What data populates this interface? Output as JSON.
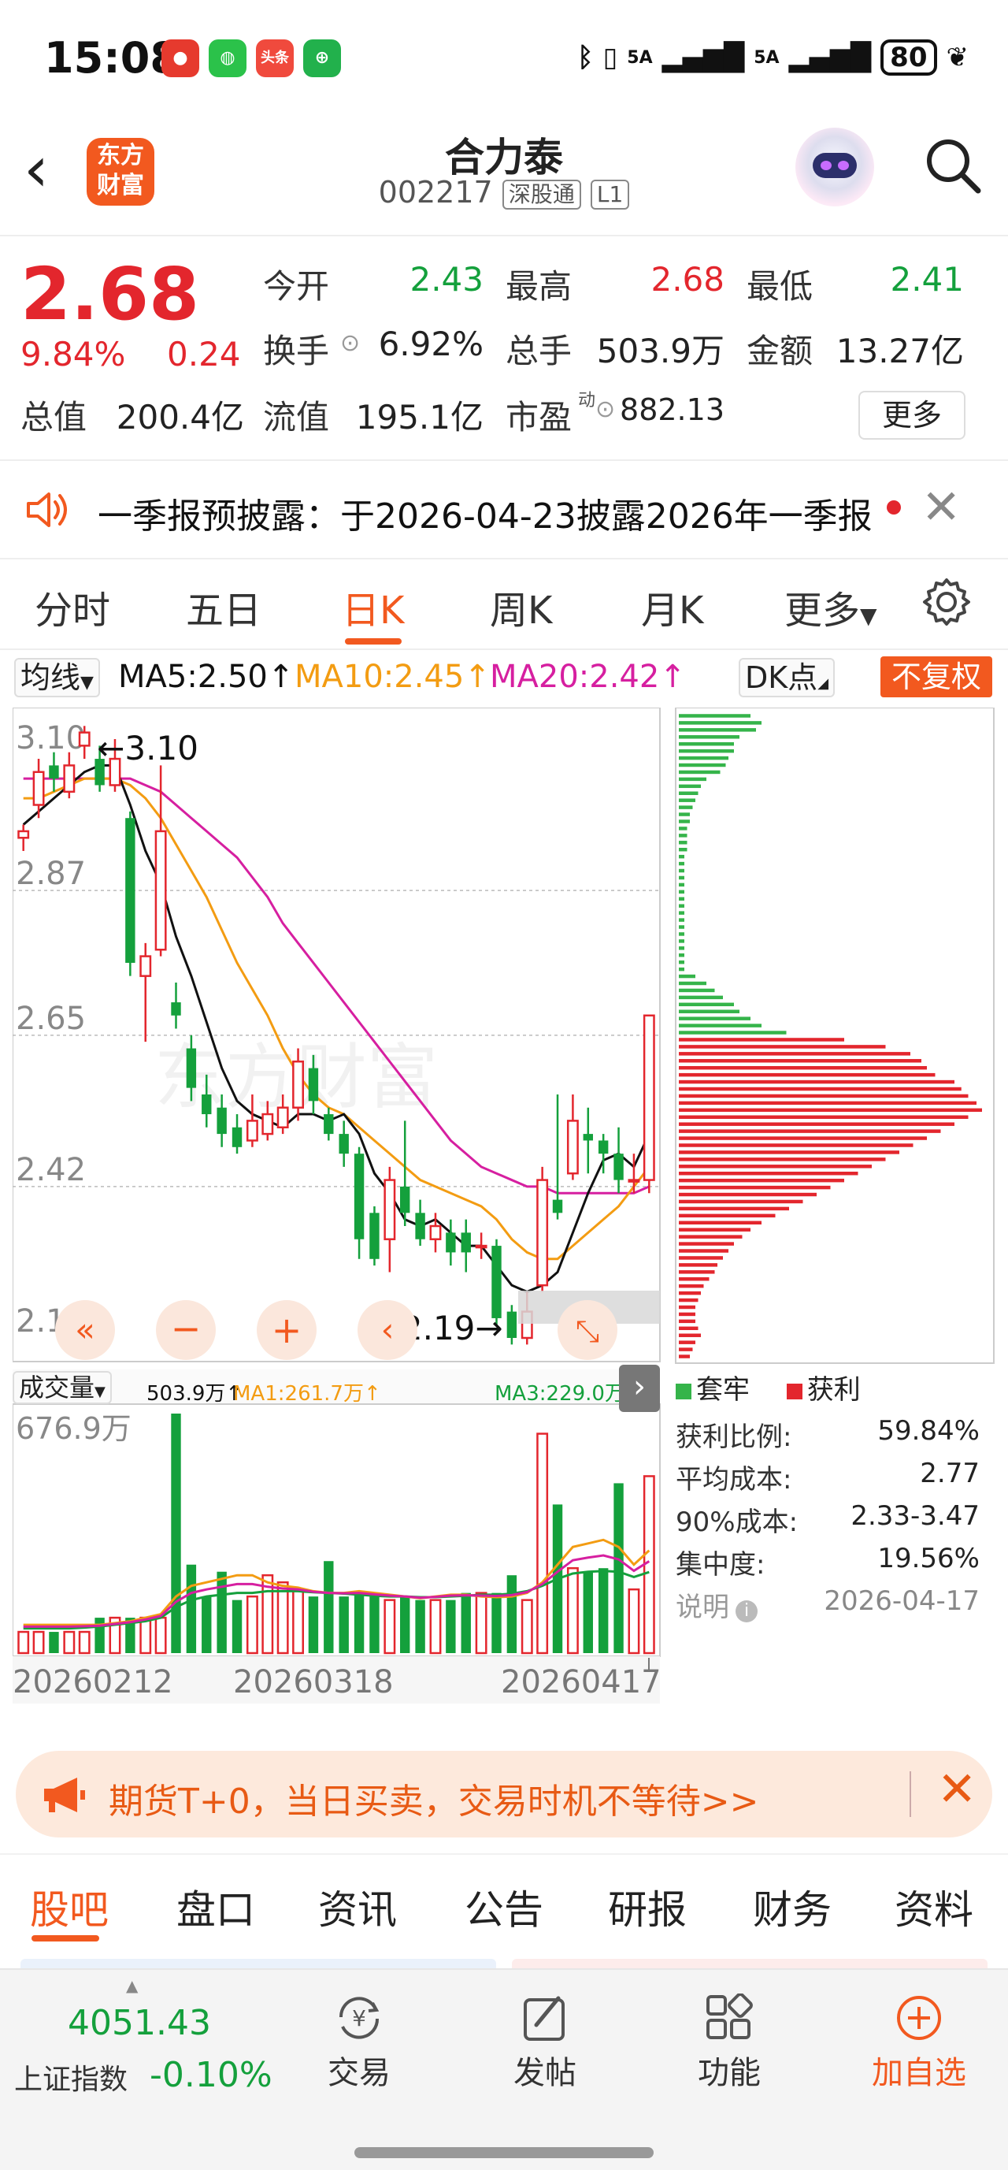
{
  "status_bar": {
    "time": "15:08",
    "app_icons": [
      "网易",
      "微信",
      "头条",
      "店"
    ],
    "signal_1": "5A",
    "signal_2": "5A",
    "battery": "80"
  },
  "header": {
    "logo_text": "东方\n财富",
    "stock_name": "合力泰",
    "stock_code": "002217",
    "tags": [
      "深股通",
      "L1"
    ]
  },
  "quote": {
    "price": "2.68",
    "change_pct": "9.84%",
    "change": "0.24",
    "fields": [
      {
        "label": "今开",
        "value": "2.43",
        "color": "green"
      },
      {
        "label": "最高",
        "value": "2.68",
        "color": "red"
      },
      {
        "label": "最低",
        "value": "2.41",
        "color": "green"
      },
      {
        "label": "换手",
        "value": "6.92%",
        "color": "black"
      },
      {
        "label": "总手",
        "value": "503.9万",
        "color": "black"
      },
      {
        "label": "金额",
        "value": "13.27亿",
        "color": "black"
      },
      {
        "label": "总值",
        "value": "200.4亿",
        "color": "black"
      },
      {
        "label": "流值",
        "value": "195.1亿",
        "color": "black"
      },
      {
        "label": "市盈",
        "value": "882.13",
        "color": "black"
      }
    ],
    "pe_superscript": "动",
    "more_label": "更多"
  },
  "notice": {
    "text": "一季报预披露：于2026-04-23披露2026年一季报"
  },
  "period_tabs": [
    "分时",
    "五日",
    "日K",
    "周K",
    "月K",
    "更多"
  ],
  "active_period": "日K",
  "ma_legend": {
    "selector": "均线",
    "ma5": "MA5:2.50↑",
    "ma10": "MA10:2.45↑",
    "ma20": "MA20:2.42↑",
    "dk_label": "DK点",
    "adjust_label": "不复权"
  },
  "volume_legend": {
    "selector": "成交量",
    "vol": "503.9万↑",
    "ma1": "MA1:261.7万↑",
    "ma3": "MA3:229.0万↑"
  },
  "chart_data": [
    {
      "type": "candlestick",
      "title": "日K",
      "y_ticks": [
        "3.10",
        "2.87",
        "2.65",
        "2.42",
        "2.19"
      ],
      "ylim": [
        2.19,
        3.1
      ],
      "annotations": [
        "3.10",
        "2.19"
      ],
      "candles": [
        [
          2.95,
          2.96,
          2.97,
          2.93
        ],
        [
          3.0,
          3.05,
          3.07,
          2.98
        ],
        [
          3.06,
          3.04,
          3.08,
          3.02
        ],
        [
          3.02,
          3.06,
          3.08,
          3.01
        ],
        [
          3.09,
          3.11,
          3.12,
          3.07
        ],
        [
          3.07,
          3.03,
          3.09,
          3.02
        ],
        [
          3.03,
          3.07,
          3.1,
          3.02
        ],
        [
          2.98,
          2.76,
          2.99,
          2.74
        ],
        [
          2.74,
          2.77,
          2.79,
          2.64
        ],
        [
          2.78,
          2.96,
          3.06,
          2.77
        ],
        [
          2.7,
          2.68,
          2.73,
          2.66
        ],
        [
          2.63,
          2.57,
          2.65,
          2.55
        ],
        [
          2.56,
          2.53,
          2.59,
          2.51
        ],
        [
          2.54,
          2.5,
          2.56,
          2.48
        ],
        [
          2.51,
          2.48,
          2.53,
          2.47
        ],
        [
          2.49,
          2.52,
          2.56,
          2.48
        ],
        [
          2.5,
          2.53,
          2.55,
          2.49
        ],
        [
          2.51,
          2.54,
          2.56,
          2.5
        ],
        [
          2.54,
          2.61,
          2.63,
          2.52
        ],
        [
          2.6,
          2.55,
          2.62,
          2.53
        ],
        [
          2.53,
          2.5,
          2.54,
          2.49
        ],
        [
          2.5,
          2.47,
          2.52,
          2.45
        ],
        [
          2.47,
          2.34,
          2.48,
          2.31
        ],
        [
          2.38,
          2.31,
          2.39,
          2.3
        ],
        [
          2.34,
          2.43,
          2.45,
          2.29
        ],
        [
          2.42,
          2.38,
          2.52,
          2.36
        ],
        [
          2.38,
          2.34,
          2.4,
          2.33
        ],
        [
          2.34,
          2.36,
          2.38,
          2.32
        ],
        [
          2.35,
          2.32,
          2.37,
          2.3
        ],
        [
          2.35,
          2.32,
          2.37,
          2.29
        ],
        [
          2.33,
          2.33,
          2.35,
          2.31
        ],
        [
          2.33,
          2.22,
          2.34,
          2.21
        ],
        [
          2.23,
          2.19,
          2.24,
          2.18
        ],
        [
          2.19,
          2.23,
          2.26,
          2.18
        ],
        [
          2.27,
          2.43,
          2.45,
          2.26
        ],
        [
          2.4,
          2.38,
          2.56,
          2.37
        ],
        [
          2.44,
          2.52,
          2.56,
          2.43
        ],
        [
          2.5,
          2.49,
          2.54,
          2.44
        ],
        [
          2.49,
          2.47,
          2.5,
          2.44
        ],
        [
          2.47,
          2.43,
          2.51,
          2.41
        ],
        [
          2.43,
          2.43,
          2.47,
          2.41
        ],
        [
          2.43,
          2.68,
          2.68,
          2.41
        ]
      ],
      "ma5": [
        2.97,
        2.99,
        3.01,
        3.03,
        3.05,
        3.06,
        3.06,
        3.0,
        2.93,
        2.88,
        2.8,
        2.74,
        2.67,
        2.6,
        2.55,
        2.53,
        2.52,
        2.51,
        2.53,
        2.53,
        2.52,
        2.53,
        2.5,
        2.44,
        2.41,
        2.37,
        2.36,
        2.37,
        2.35,
        2.33,
        2.33,
        2.3,
        2.27,
        2.26,
        2.27,
        2.29,
        2.35,
        2.41,
        2.46,
        2.47,
        2.45,
        2.5
      ],
      "ma10": [
        3.01,
        3.01,
        3.02,
        3.03,
        3.04,
        3.04,
        3.04,
        3.03,
        3.01,
        2.98,
        2.94,
        2.9,
        2.86,
        2.81,
        2.76,
        2.72,
        2.68,
        2.63,
        2.59,
        2.56,
        2.54,
        2.53,
        2.51,
        2.49,
        2.47,
        2.45,
        2.43,
        2.42,
        2.41,
        2.4,
        2.39,
        2.37,
        2.34,
        2.32,
        2.31,
        2.31,
        2.33,
        2.35,
        2.37,
        2.39,
        2.42,
        2.45
      ],
      "ma20": [
        3.04,
        3.04,
        3.04,
        3.04,
        3.04,
        3.04,
        3.04,
        3.04,
        3.03,
        3.02,
        3.0,
        2.98,
        2.96,
        2.94,
        2.92,
        2.89,
        2.86,
        2.82,
        2.79,
        2.76,
        2.73,
        2.7,
        2.67,
        2.64,
        2.61,
        2.58,
        2.55,
        2.52,
        2.49,
        2.47,
        2.45,
        2.44,
        2.43,
        2.42,
        2.42,
        2.41,
        2.41,
        2.41,
        2.41,
        2.41,
        2.41,
        2.42
      ],
      "color_up": "#e3262d",
      "color_down": "#14a03c",
      "ma_colors": {
        "ma5": "#111111",
        "ma10": "#f39c12",
        "ma20": "#d61fa0"
      }
    },
    {
      "type": "bar",
      "title": "成交量",
      "y_ticks": [
        "676.9万"
      ],
      "ylim": [
        0,
        676.9
      ],
      "x_ticks": [
        "20260212",
        "20260318",
        "20260417"
      ],
      "values": [
        60,
        60,
        60,
        60,
        60,
        100,
        100,
        100,
        100,
        100,
        676.9,
        250,
        160,
        230,
        150,
        160,
        220,
        200,
        180,
        160,
        260,
        160,
        170,
        160,
        150,
        160,
        150,
        150,
        150,
        170,
        170,
        170,
        220,
        150,
        620,
        420,
        240,
        230,
        240,
        480,
        180,
        500
      ],
      "ma1": [
        80,
        80,
        80,
        80,
        80,
        80,
        85,
        90,
        100,
        110,
        160,
        190,
        200,
        210,
        220,
        220,
        200,
        190,
        185,
        175,
        170,
        170,
        175,
        170,
        165,
        160,
        155,
        160,
        165,
        165,
        160,
        158,
        160,
        170,
        200,
        250,
        300,
        310,
        320,
        300,
        250,
        290
      ],
      "ma3": [
        70,
        70,
        70,
        70,
        72,
        75,
        80,
        85,
        90,
        100,
        130,
        150,
        160,
        165,
        170,
        170,
        175,
        175,
        175,
        172,
        170,
        168,
        165,
        162,
        160,
        160,
        158,
        158,
        160,
        162,
        165,
        165,
        168,
        175,
        190,
        210,
        225,
        230,
        232,
        230,
        215,
        229
      ]
    },
    {
      "type": "bar",
      "title": "筹码分布",
      "orientation": "horizontal",
      "legend": [
        "套牢",
        "获利"
      ],
      "profit_ratio": "59.84%",
      "avg_cost": "2.77",
      "cost_90": "2.33-3.47",
      "concentration": "19.56%",
      "date": "2026-04-17"
    }
  ],
  "chip_panel": {
    "legend_trapped": "套牢",
    "legend_profit": "获利",
    "rows": [
      {
        "label": "获利比例:",
        "value": "59.84%"
      },
      {
        "label": "平均成本:",
        "value": "2.77"
      },
      {
        "label": "90%成本:",
        "value": "2.33-3.47"
      },
      {
        "label": "集中度:",
        "value": "19.56%"
      },
      {
        "label": "说明",
        "value": "2026-04-17"
      }
    ]
  },
  "ad_banner": {
    "text": "期货T+0，当日买卖，交易时机不等待>>"
  },
  "info_tabs": [
    "股吧",
    "盘口",
    "资讯",
    "公告",
    "研报",
    "财务",
    "资料"
  ],
  "active_info_tab": "股吧",
  "bottom_nav": {
    "index_value": "4051.43",
    "index_name": "上证指数",
    "index_pct": "-0.10%",
    "items": [
      "交易",
      "发帖",
      "功能",
      "加自选"
    ]
  }
}
